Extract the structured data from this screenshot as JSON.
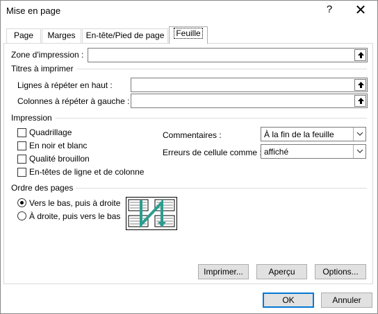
{
  "window": {
    "title": "Mise en page",
    "help_glyph": "?",
    "close_glyph": "✕"
  },
  "tabs": [
    {
      "label": "Page",
      "active": false
    },
    {
      "label": "Marges",
      "active": false
    },
    {
      "label": "En-tête/Pied de page",
      "active": false
    },
    {
      "label": "Feuille",
      "active": true
    }
  ],
  "print_area": {
    "label": "Zone d'impression :",
    "value": ""
  },
  "print_titles": {
    "group_label": "Titres à imprimer",
    "rows_label": "Lignes à répéter en haut :",
    "rows_value": "",
    "cols_label": "Colonnes à répéter à gauche :",
    "cols_value": ""
  },
  "print": {
    "group_label": "Impression",
    "checkboxes": [
      {
        "label": "Quadrillage",
        "checked": false
      },
      {
        "label": "En noir et blanc",
        "checked": false
      },
      {
        "label": "Qualité brouillon",
        "checked": false
      },
      {
        "label": "En-têtes de ligne et de colonne",
        "checked": false
      }
    ],
    "comments_label": "Commentaires :",
    "comments_value": "À la fin de la feuille",
    "errors_label": "Erreurs de cellule comme :",
    "errors_value": "affiché"
  },
  "page_order": {
    "group_label": "Ordre des pages",
    "options": [
      {
        "label": "Vers le bas, puis à droite",
        "selected": true
      },
      {
        "label": "À droite, puis vers le bas",
        "selected": false
      }
    ],
    "icon": "page-order-down-then-over-icon"
  },
  "actions": {
    "print": "Imprimer...",
    "preview": "Aperçu",
    "options": "Options..."
  },
  "footer": {
    "ok": "OK",
    "cancel": "Annuler"
  },
  "colors": {
    "accent": "#0078d7",
    "button_bg": "#e1e1e1",
    "icon_teal": "#2a9d8f"
  }
}
